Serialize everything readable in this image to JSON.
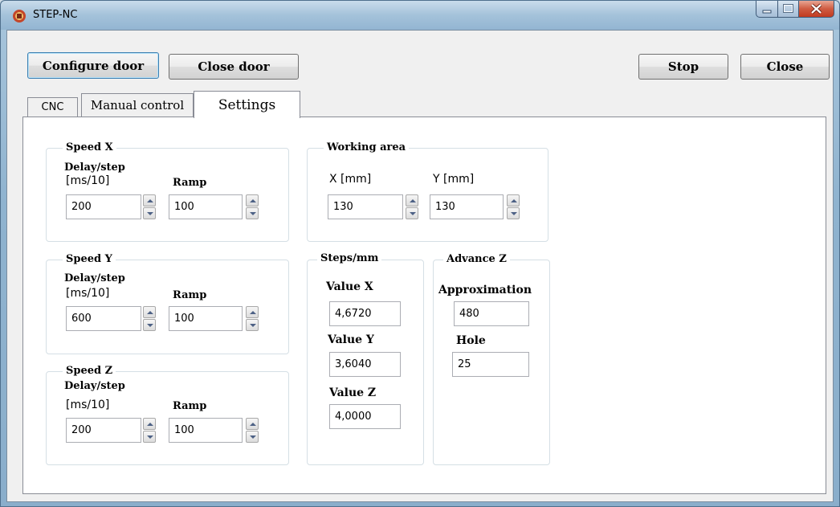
{
  "window": {
    "title": "STEP-NC"
  },
  "toolbar": {
    "configure_door": "Configure door",
    "close_door": "Close door",
    "stop": "Stop",
    "close": "Close"
  },
  "tabs": [
    {
      "label": "CNC"
    },
    {
      "label": "Manual control"
    },
    {
      "label": "Settings",
      "selected": true
    }
  ],
  "speed_x": {
    "title": "Speed X",
    "delay_label": "Delay/step",
    "delay_unit": "[ms/10]",
    "ramp_label": "Ramp",
    "delay_value": "200",
    "ramp_value": "100"
  },
  "speed_y": {
    "title": "Speed Y",
    "delay_label": "Delay/step",
    "delay_unit": "[ms/10]",
    "ramp_label": "Ramp",
    "delay_value": "600",
    "ramp_value": "100"
  },
  "speed_z": {
    "title": "Speed Z",
    "delay_label": "Delay/step",
    "delay_unit": "[ms/10]",
    "ramp_label": "Ramp",
    "delay_value": "200",
    "ramp_value": "100"
  },
  "working_area": {
    "title": "Working area",
    "x_label": "X [mm]",
    "y_label": "Y [mm]",
    "x_value": "130",
    "y_value": "130"
  },
  "steps_mm": {
    "title": "Steps/mm",
    "value_x_label": "Value X",
    "value_x": "4,6720",
    "value_y_label": "Value Y",
    "value_y": "3,6040",
    "value_z_label": "Value Z",
    "value_z": "4,0000"
  },
  "advance_z": {
    "title": "Advance Z",
    "approximation_label": "Approximation",
    "approximation_value": "480",
    "hole_label": "Hole",
    "hole_value": "25"
  },
  "colors": {
    "titlebar": "#a4c2da",
    "client_bg": "#f0f0f0",
    "panel_bg": "#ffffff",
    "close_button": "#c23b20"
  },
  "icons": {
    "app": "app-icon",
    "minimize": "minimize-icon",
    "maximize": "maximize-icon",
    "close": "close-icon"
  }
}
